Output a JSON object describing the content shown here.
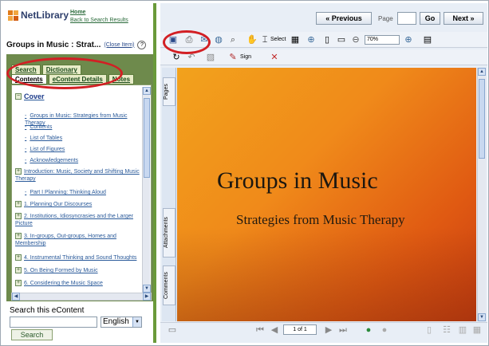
{
  "brand": {
    "name": "NetLibrary",
    "home": "Home",
    "back": "Back to Search Results"
  },
  "doc_title": "Groups in Music : Strat...",
  "close_item": "(Close Item)",
  "tabs_row1": [
    "Search",
    "Dictionary"
  ],
  "tabs_row2": [
    "Contents",
    "eContent Details",
    "Notes"
  ],
  "toc": [
    {
      "label": "Cover",
      "type": "root"
    },
    {
      "label": "Groups in Music: Strategies from Music Therapy",
      "type": "leaf"
    },
    {
      "label": "Contents",
      "type": "leaf"
    },
    {
      "label": "List of Tables",
      "type": "leaf"
    },
    {
      "label": "List of Figures",
      "type": "leaf"
    },
    {
      "label": "Acknowledgements",
      "type": "leaf"
    },
    {
      "label": "Introduction: Music, Society and Shifting Music Therapy",
      "type": "node"
    },
    {
      "label": "Part I Planning: Thinking Aloud",
      "type": "leaf"
    },
    {
      "label": "1. Planning Our Discourses",
      "type": "node"
    },
    {
      "label": "2. Institutions, Idiosyncrasies and the Larger Picture",
      "type": "node"
    },
    {
      "label": "3. In-groups, Out-groups, Homes and Membership",
      "type": "node"
    },
    {
      "label": "4. Instrumental Thinking and Sound Thoughts",
      "type": "node"
    },
    {
      "label": "5. On Being Formed by Music",
      "type": "node"
    },
    {
      "label": "6. Considering the Music Space",
      "type": "node"
    }
  ],
  "search": {
    "label": "Search this eContent",
    "lang": "English",
    "button": "Search"
  },
  "nav": {
    "prev": "« Previous",
    "page_label": "Page",
    "go": "Go",
    "next": "Next »"
  },
  "toolbar": {
    "select": "Select",
    "zoom": "70%",
    "sign": "Sign"
  },
  "side_tabs": [
    "Pages",
    "Attachments",
    "Comments"
  ],
  "document": {
    "title": "Groups in Music",
    "subtitle": "Strategies from Music Therapy"
  },
  "bottom": {
    "page_of": "1 of 1"
  }
}
